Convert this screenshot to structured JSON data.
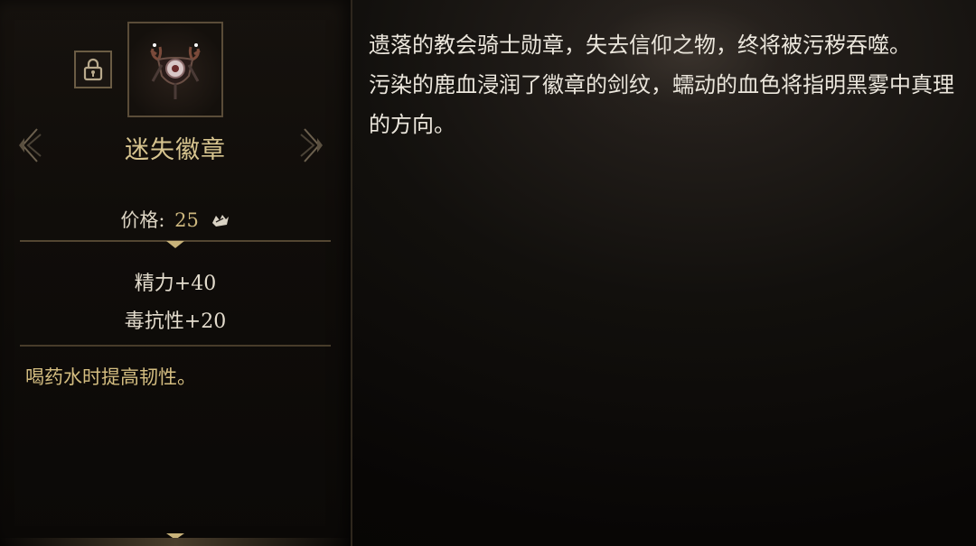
{
  "item": {
    "name": "迷失徽章",
    "price_label": "价格:",
    "price_value": "25",
    "stats": [
      "精力+40",
      "毒抗性+20"
    ],
    "effect": "喝药水时提高韧性。",
    "icons": {
      "lock": "lock-icon",
      "item": "antler-badge-icon",
      "currency": "coin-icon",
      "prev": "arrow-left-icon",
      "next": "arrow-right-icon",
      "scroll": "chevron-down-icon"
    }
  },
  "description": {
    "paragraphs": [
      "遗落的教会骑士勋章，失去信仰之物，终将被污秽吞噬。",
      "污染的鹿血浸润了徽章的剑纹，蠕动的血色将指明黑雾中真理的方向。"
    ]
  },
  "colors": {
    "gold": "#d7c48f",
    "text": "#ebe6dc",
    "frame": "#5a4c38"
  }
}
